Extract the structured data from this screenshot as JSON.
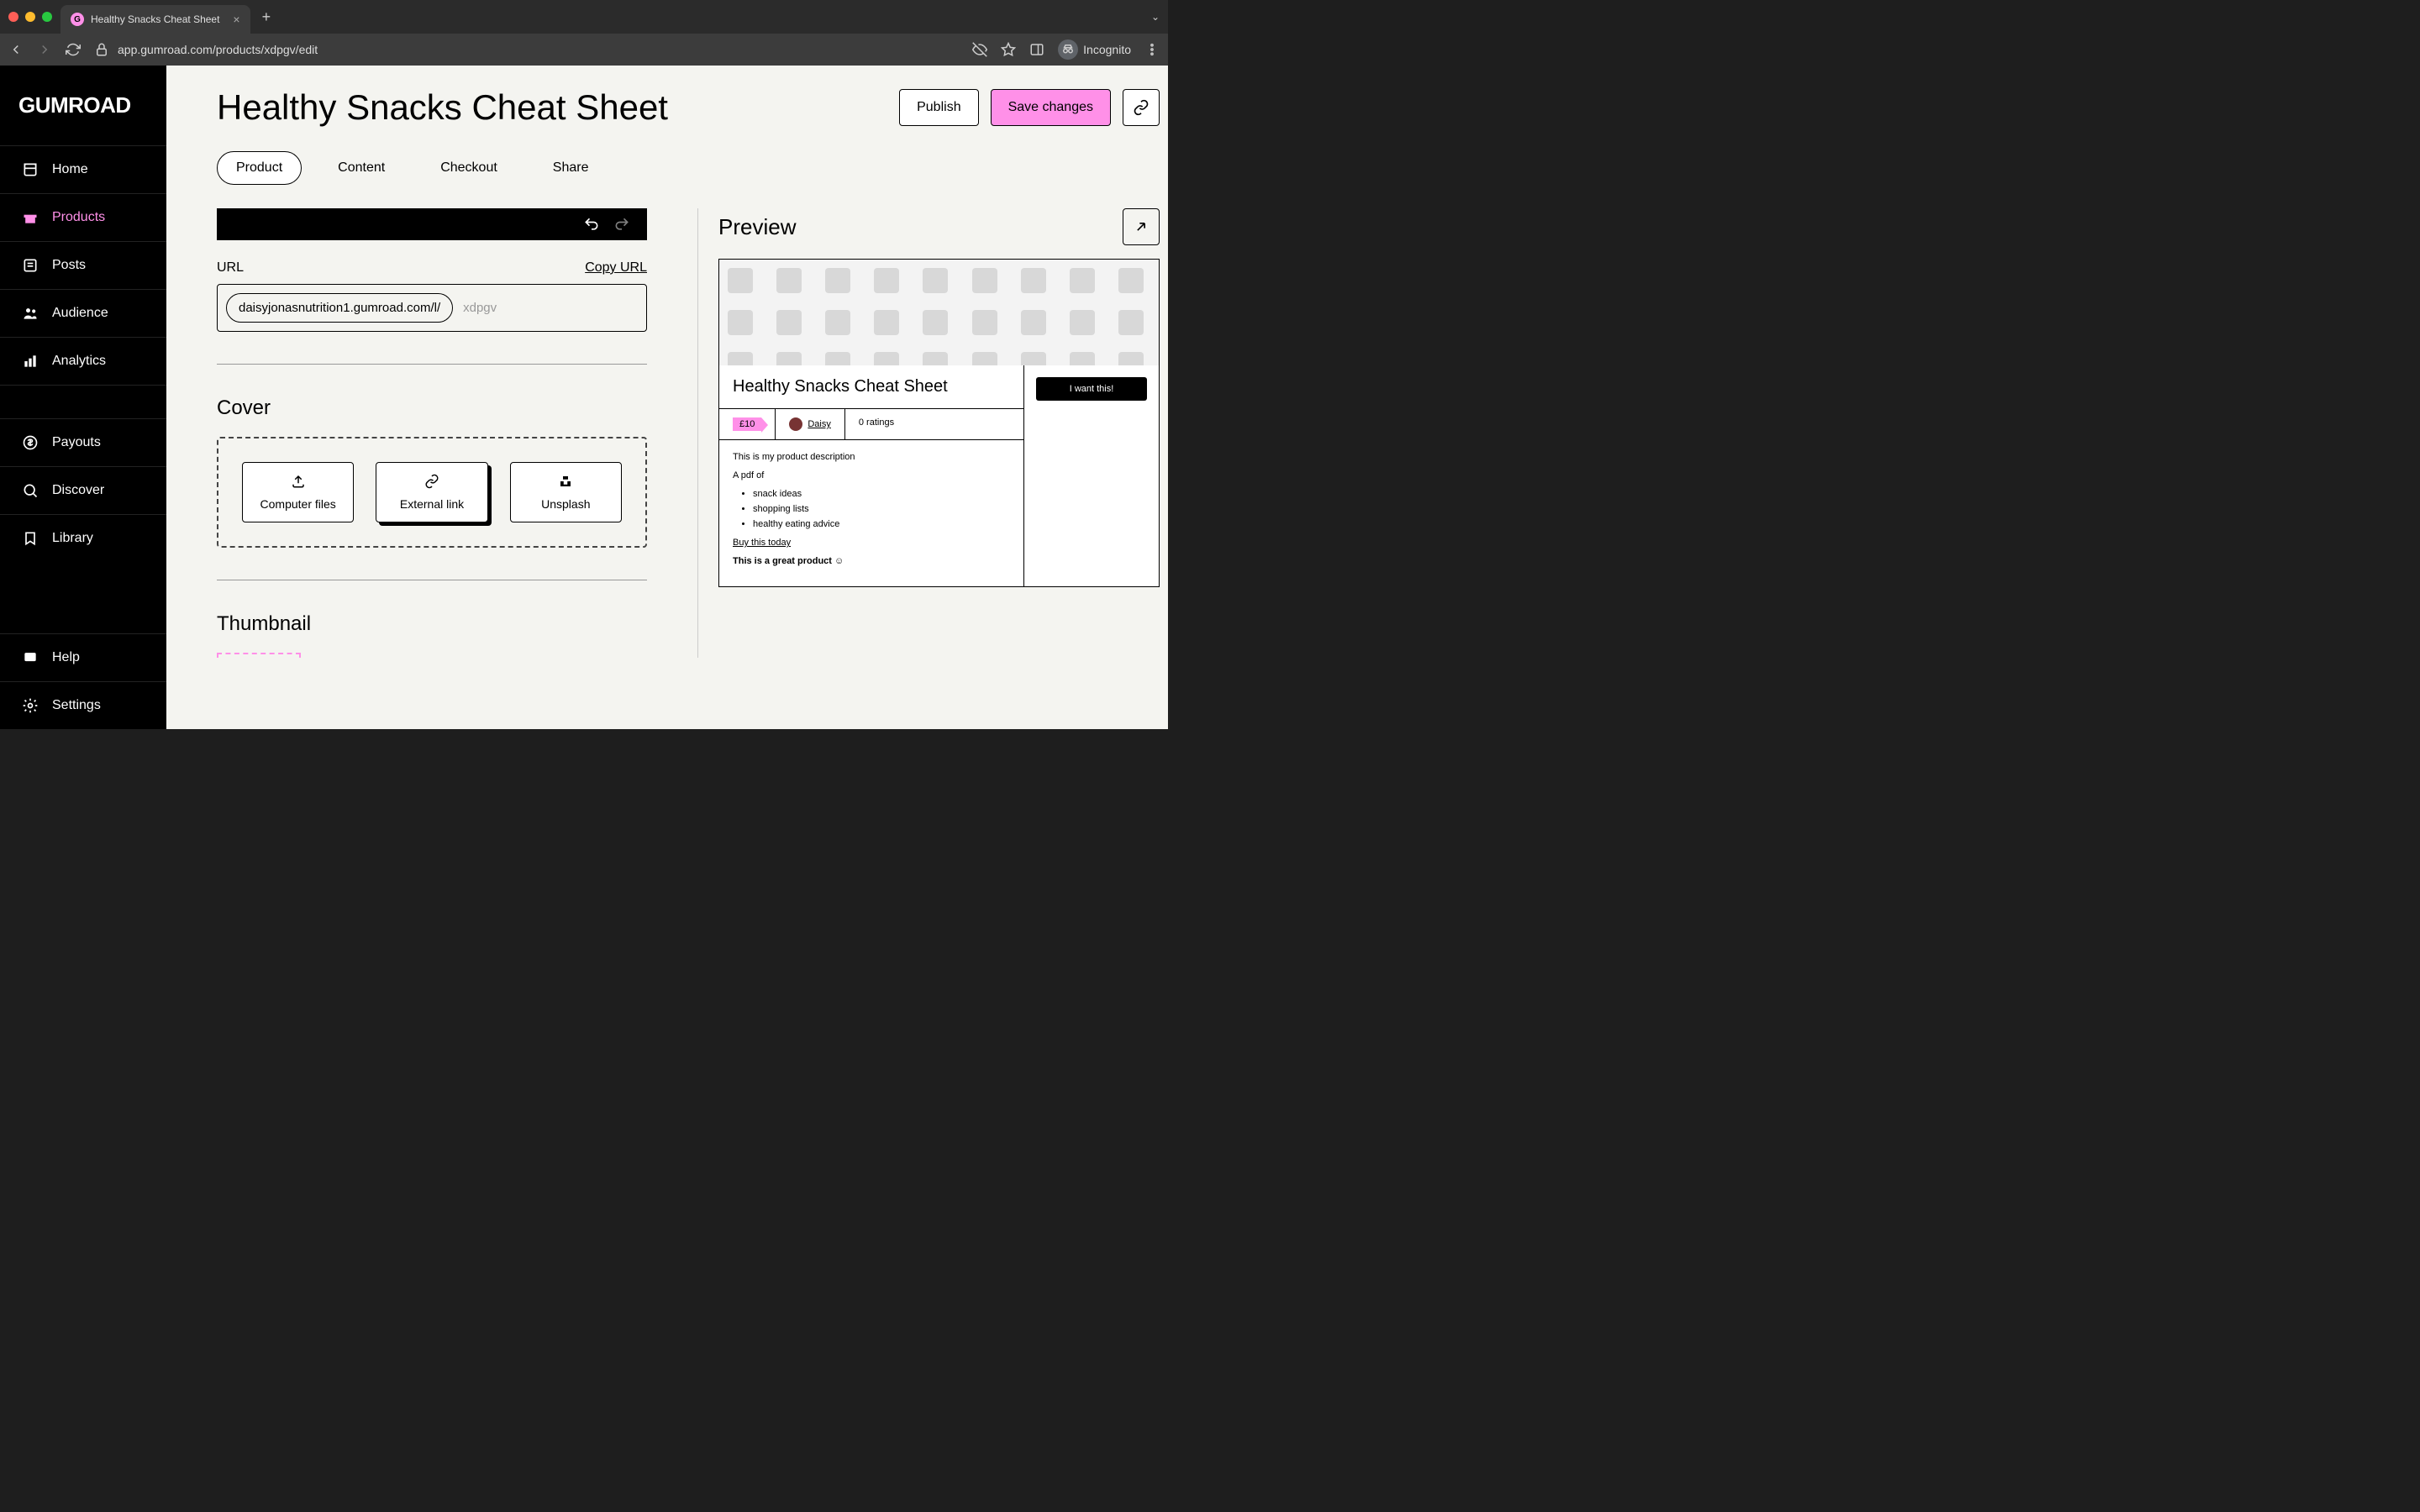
{
  "browser": {
    "tab_title": "Healthy Snacks Cheat Sheet",
    "url": "app.gumroad.com/products/xdpgv/edit",
    "incognito": "Incognito"
  },
  "sidebar": {
    "logo": "GUMROAD",
    "items": [
      {
        "label": "Home"
      },
      {
        "label": "Products"
      },
      {
        "label": "Posts"
      },
      {
        "label": "Audience"
      },
      {
        "label": "Analytics"
      },
      {
        "label": "Payouts"
      },
      {
        "label": "Discover"
      },
      {
        "label": "Library"
      },
      {
        "label": "Help"
      },
      {
        "label": "Settings"
      }
    ]
  },
  "header": {
    "title": "Healthy Snacks Cheat Sheet",
    "publish": "Publish",
    "save": "Save changes"
  },
  "tabs": {
    "product": "Product",
    "content": "Content",
    "checkout": "Checkout",
    "share": "Share"
  },
  "url_section": {
    "label": "URL",
    "copy": "Copy URL",
    "prefix": "daisyjonasnutrition1.gumroad.com/l/",
    "slug": "xdpgv"
  },
  "cover": {
    "heading": "Cover",
    "computer_files": "Computer files",
    "external_link": "External link",
    "unsplash": "Unsplash"
  },
  "thumbnail": {
    "heading": "Thumbnail"
  },
  "preview": {
    "label": "Preview",
    "product_title": "Healthy Snacks Cheat Sheet",
    "price": "£10",
    "author": "Daisy",
    "ratings": "0 ratings",
    "desc_intro": "This is my product description",
    "desc_pdf": "A pdf of",
    "bullets": [
      "snack ideas",
      "shopping lists",
      "healthy eating advice"
    ],
    "buy_link": "Buy this today",
    "great": "This is a great product ☺",
    "want": "I want this!"
  }
}
